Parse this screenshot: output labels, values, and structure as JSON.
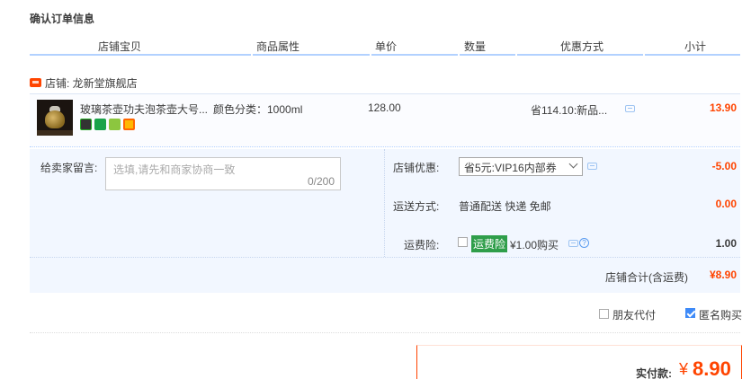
{
  "title": "确认订单信息",
  "columns": [
    "店铺宝贝",
    "商品属性",
    "单价",
    "数量",
    "优惠方式",
    "小计"
  ],
  "shop": {
    "label": "店铺: 龙新堂旗舰店",
    "icon": "tmall-shop-icon"
  },
  "item": {
    "name": "玻璃茶壶功夫泡茶壶大号...",
    "attr": "颜色分类：1000ml",
    "price": "128.00",
    "promo": "省114.10:新品...",
    "subtotal": "13.90",
    "badges": [
      "guarantee-badge",
      "seven-day-return-badge",
      "warranty-badge",
      "card-payment-badge"
    ]
  },
  "message": {
    "label": "给卖家留言:",
    "placeholder": "选填,请先和商家协商一致",
    "count": "0/200"
  },
  "options": {
    "coupon_label": "店铺优惠:",
    "coupon_value": "省5元:VIP16内部券",
    "coupon_amount": "-5.00",
    "shipping_label": "运送方式:",
    "shipping_value": "普通配送 快递 免邮",
    "shipping_amount": "0.00",
    "insurance_label": "运费险:",
    "insurance_badge": "运费险",
    "insurance_value": "¥1.00购买",
    "insurance_amount": "1.00"
  },
  "shop_total": {
    "label": "店铺合计(含运费)",
    "value": "¥8.90"
  },
  "bottom": {
    "friend_pay": "朋友代付",
    "friend_pay_checked": false,
    "anonymous": "匿名购买",
    "anonymous_checked": true
  },
  "payment": {
    "label": "实付款:",
    "yen": "¥",
    "amount": "8.90"
  },
  "colors": {
    "accent": "#ff4400",
    "header_bar": "#b2d1ff",
    "panel": "#f2f7ff",
    "checkbox": "#3e8af8"
  }
}
